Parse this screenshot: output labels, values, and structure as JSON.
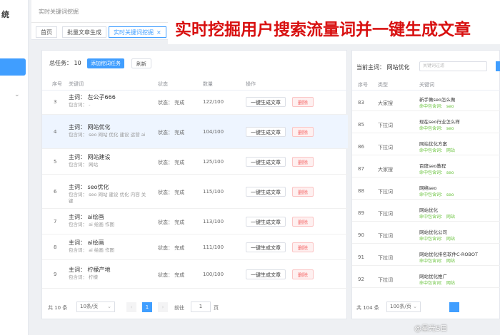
{
  "sidebar": {
    "title": "统"
  },
  "header": {
    "title": "实时关键词挖掘"
  },
  "tabs": [
    {
      "label": "首页"
    },
    {
      "label": "批量文章生成"
    },
    {
      "label": "实时关键词挖掘",
      "active": true,
      "close": "×"
    }
  ],
  "banner": {
    "text": "实时挖掘用户搜索流量词并一键生成文章"
  },
  "left_panel": {
    "total_label": "总任务： 10",
    "add_button": "添加挖词任务",
    "refresh_button": "刷新",
    "columns": [
      "序号",
      "关键词",
      "状态",
      "数量",
      "操作"
    ],
    "rows": [
      {
        "index": "3",
        "main": "主词：  左公子666",
        "sub": "包含词：  -",
        "status": "状态：  完成",
        "count": "122/100",
        "op": "一键生成文章",
        "del": "删除"
      },
      {
        "index": "4",
        "main": "主词：  网站优化",
        "sub": "包含词：  seo 网站 优化 建设 运营 ai",
        "status": "状态：  完成",
        "count": "104/100",
        "op": "一键生成文章",
        "del": "删除",
        "highlight": true
      },
      {
        "index": "5",
        "main": "主词：  网站建设",
        "sub": "包含词：  网站",
        "status": "状态：  完成",
        "count": "125/100",
        "op": "一键生成文章",
        "del": "删除"
      },
      {
        "index": "6",
        "main": "主词：  seo优化",
        "sub": "包含词：  seo 网站 建设 优化 内容 关键",
        "status": "状态：  完成",
        "count": "115/100",
        "op": "一键生成文章",
        "del": "删除"
      },
      {
        "index": "7",
        "main": "主词：  ai绘画",
        "sub": "包含词：  ai 绘画 作图",
        "status": "状态：  完成",
        "count": "113/100",
        "op": "一键生成文章",
        "del": "删除"
      },
      {
        "index": "8",
        "main": "主词：  ai绘画",
        "sub": "包含词：  ai 绘画 作图",
        "status": "状态：  完成",
        "count": "111/100",
        "op": "一键生成文章",
        "del": "删除"
      },
      {
        "index": "9",
        "main": "主词：  柠檬产地",
        "sub": "包含词：  柠檬",
        "status": "状态：  完成",
        "count": "100/100",
        "op": "一键生成文章",
        "del": "删除"
      }
    ],
    "pagination": {
      "total": "共 10 条",
      "page_size": "10条/页",
      "current": "1",
      "goto": "前往",
      "goto_value": "1",
      "unit": "页"
    }
  },
  "right_panel": {
    "main_word_label": "当前主词：  网站优化",
    "search_placeholder": "关键词过滤",
    "columns": [
      "序号",
      "类型",
      "关键词"
    ],
    "rows": [
      {
        "index": "83",
        "type": "大家搜",
        "keyword": "新手做seo怎么做",
        "tag": "命中包含词：  seo"
      },
      {
        "index": "85",
        "type": "下拉词",
        "keyword": "现在seo行业怎么样",
        "tag": "命中包含词：  seo"
      },
      {
        "index": "86",
        "type": "下拉词",
        "keyword": "网站优化方案",
        "tag": "命中包含词：  网站"
      },
      {
        "index": "87",
        "type": "大家搜",
        "keyword": "百度seo教程",
        "tag": "命中包含词：  seo"
      },
      {
        "index": "88",
        "type": "下拉词",
        "keyword": "网络seo",
        "tag": "命中包含词：  seo"
      },
      {
        "index": "89",
        "type": "下拉词",
        "keyword": "网站优化",
        "tag": "命中包含词：  网站"
      },
      {
        "index": "90",
        "type": "下拉词",
        "keyword": "网站优化公司",
        "tag": "命中包含词：  网站"
      },
      {
        "index": "91",
        "type": "下拉词",
        "keyword": "网站优化排名软件C-ROBOT",
        "tag": "命中包含词：  网站"
      },
      {
        "index": "92",
        "type": "下拉词",
        "keyword": "网站优化推广",
        "tag": "命中包含词：  网站"
      }
    ],
    "pagination": {
      "total": "共 104 条",
      "page_size": "100条/页"
    }
  },
  "watermark": {
    "text": "@星光S日"
  },
  "colors": {
    "accent": "#409eff",
    "banner_red": "#d81010",
    "danger": "#f56c6c",
    "tag_green": "#67c23a"
  }
}
